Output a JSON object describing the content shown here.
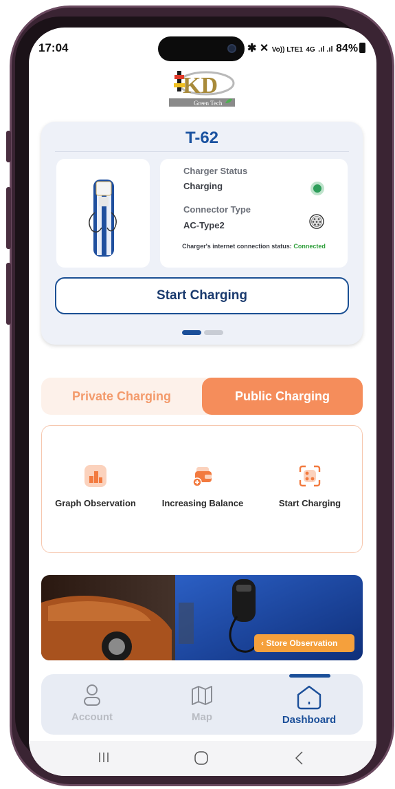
{
  "status_bar": {
    "time": "17:04",
    "volte": "Vo)) LTE1",
    "net": "4G",
    "battery": "84%"
  },
  "logo": {
    "text": "KD",
    "subtitle": "Green Tech"
  },
  "charger": {
    "name": "T-62",
    "status_label": "Charger Status",
    "status_value": "Charging",
    "status_color": "#2e9e5a",
    "connector_label": "Connector Type",
    "connector_value": "AC-Type2",
    "net_label": "Charger's internet connection status:",
    "net_value": "Connected",
    "start_button": "Start Charging",
    "pager_active": 1,
    "pager_total": 2
  },
  "tabs": {
    "private": "Private Charging",
    "public": "Public Charging",
    "selected": "public"
  },
  "actions": [
    {
      "label": "Graph Observation",
      "icon": "graph-icon"
    },
    {
      "label": "Increasing Balance",
      "icon": "wallet-add-icon"
    },
    {
      "label": "Start Charging",
      "icon": "scan-icon"
    }
  ],
  "banner": {
    "button": "Store Observation"
  },
  "bottom_nav": [
    {
      "label": "Account",
      "icon": "user-icon",
      "active": false
    },
    {
      "label": "Map",
      "icon": "map-icon",
      "active": false
    },
    {
      "label": "Dashboard",
      "icon": "home-icon",
      "active": true
    }
  ],
  "colors": {
    "primary": "#1b4f99",
    "accent": "#f58d5b",
    "connected": "#2e9e3a"
  }
}
